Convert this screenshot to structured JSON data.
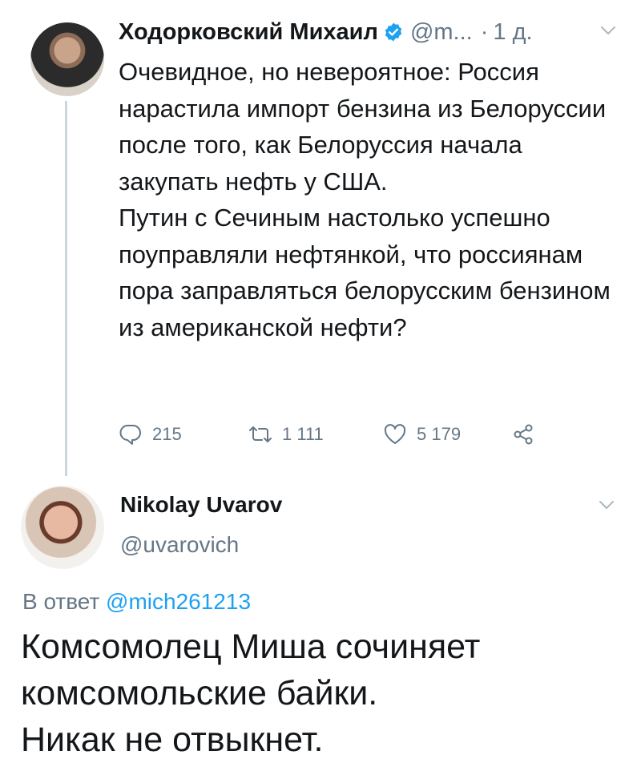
{
  "tweet1": {
    "author_name": "Ходорковский Михаил",
    "handle": "@m...",
    "separator": "·",
    "time": "1 д.",
    "text_paragraphs": [
      "Очевидное, но невероятное: Россия нарастила импорт бензина из Белоруссии после того, как Белоруссия начала закупать нефть у США.",
      "Путин с Сечиным настолько успешно поуправляли нефтянкой, что россиянам пора заправляться белорусским бензином из американской нефти?"
    ],
    "replies_count": "215",
    "retweets_count": "1 111",
    "likes_count": "5 179"
  },
  "tweet2": {
    "author_name": "Nikolay Uvarov",
    "handle": "@uvarovich",
    "reply_label": "В ответ",
    "reply_to_handle": "@mich261213",
    "text_paragraphs": [
      "Комсомолец Миша сочиняет комсомольские байки.",
      "Никак не отвыкнет."
    ]
  },
  "colors": {
    "accent": "#1da1f2",
    "secondary_text": "#657786",
    "primary_text": "#14171a",
    "thread_line": "#ccd6dd"
  },
  "icons": [
    "verified-badge-icon",
    "chevron-down-icon",
    "reply-icon",
    "retweet-icon",
    "like-icon",
    "share-icon"
  ]
}
